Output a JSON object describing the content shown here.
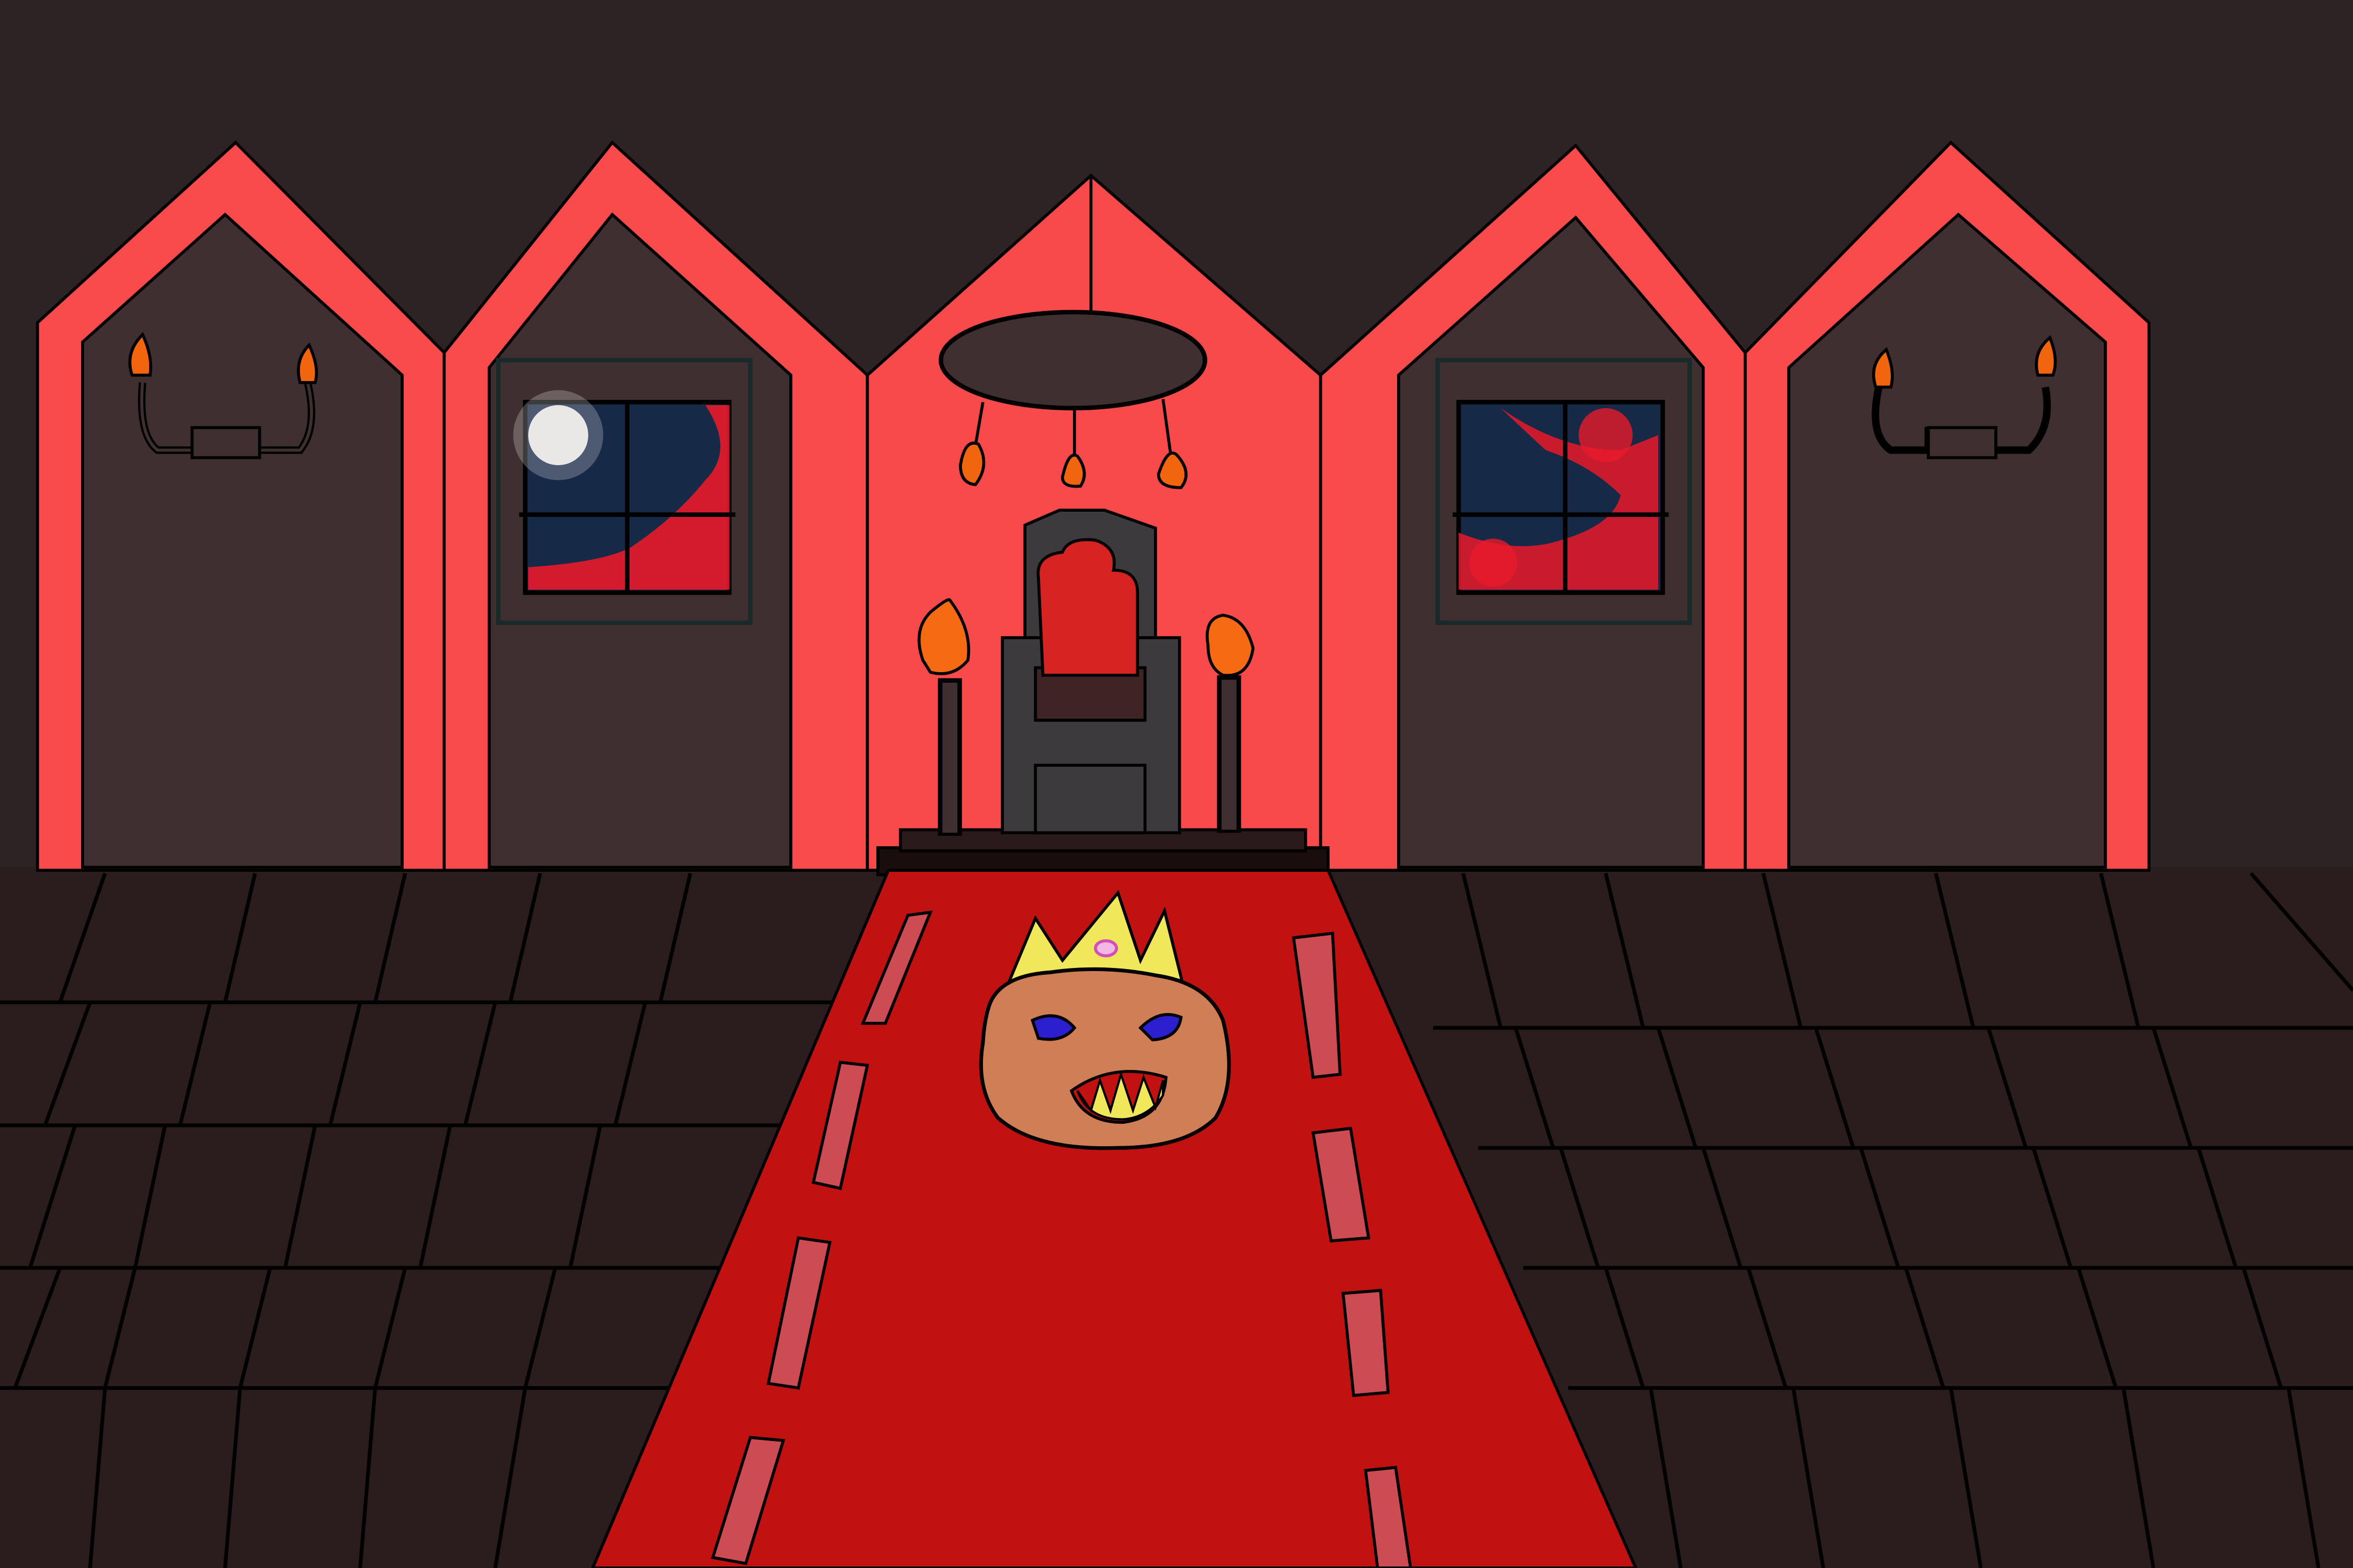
{
  "scene": {
    "kind": "hand-drawn throne room backdrop",
    "text_labels": []
  },
  "palette": {
    "wall_top": "#2e2324",
    "arch_stroke": "#f94b4b",
    "panel_fill": "#3f2f31",
    "center_panel": "#f84a4a",
    "floor": "#2b1c1d",
    "carpet": "#c11111",
    "carpet_stripe": "#cd4b52",
    "throne": "#3c3a3c",
    "throne_cushion": "#d82323",
    "torch_flame": "#f66a12",
    "candle_flame": "#f2650f",
    "night_sky": "#162947",
    "moon": "#f2f0ee",
    "crown": "#f0e85a",
    "face": "#d07e55",
    "eyes": "#2b1fd0",
    "outline": "#000000"
  },
  "icons": {
    "left_window": "window-moon-icon",
    "right_window": "window-night-icon",
    "chandelier": "chandelier-icon",
    "sconce": "wall-sconce-icon",
    "throne": "throne-icon",
    "torch": "torch-icon",
    "crown": "crown-icon",
    "monster": "crowned-monster-icon"
  }
}
